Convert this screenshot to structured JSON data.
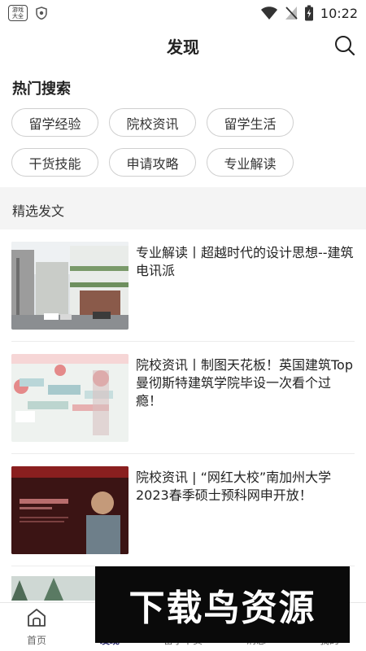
{
  "status_bar": {
    "app_icon_text": "游戏\n大全",
    "time": "10:22"
  },
  "header": {
    "title": "发现"
  },
  "hot_search": {
    "title": "热门搜索",
    "tags": [
      "留学经验",
      "院校资讯",
      "留学生活",
      "干货技能",
      "申请攻略",
      "专业解读"
    ]
  },
  "featured": {
    "title": "精选发文",
    "articles": [
      {
        "title": "专业解读丨超越时代的设计思想--建筑电讯派",
        "thumb": "street-photo"
      },
      {
        "title": "院校资讯丨制图天花板！英国建筑Top曼彻斯特建筑学院毕设一次看个过瘾！",
        "thumb": "architecture-drawing"
      },
      {
        "title": "院校资讯 | “网红大校”南加州大学2023春季硕士预科网申开放！",
        "thumb": "academy-admissions"
      }
    ]
  },
  "bottom_nav": {
    "items": [
      {
        "label": "首页",
        "icon": "home-icon"
      },
      {
        "label": "发现",
        "icon": "discover-icon"
      },
      {
        "label": "留学干货",
        "icon": "book-icon"
      },
      {
        "label": "消息",
        "icon": "message-icon"
      },
      {
        "label": "我的",
        "icon": "profile-icon"
      }
    ],
    "active_index": 1
  },
  "watermark": {
    "text": "下载鸟资源"
  },
  "colors": {
    "accent": "#2a2a6e",
    "chip_border": "#cfcfcf",
    "section_bg": "#f4f4f4"
  }
}
